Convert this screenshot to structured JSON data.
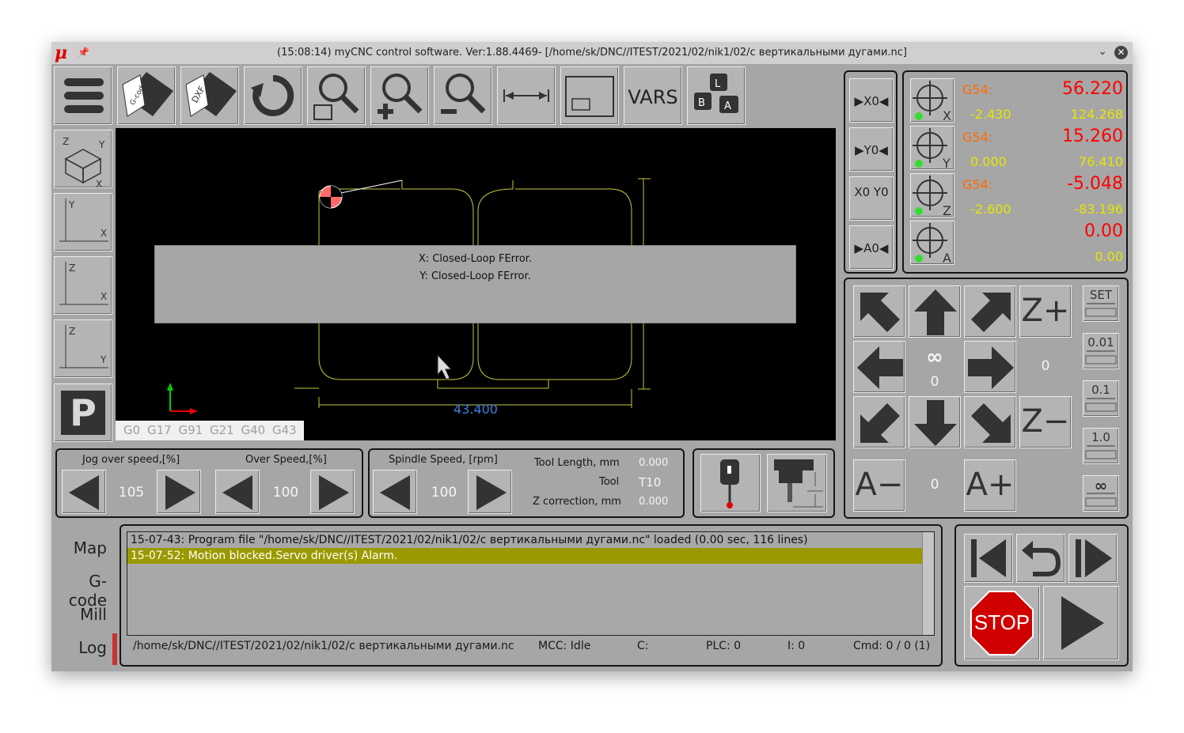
{
  "window": {
    "title": "(15:08:14) myCNC control software. Ver:1.88.4469- [/home/sk/DNC//ITEST/2021/02/nik1/02/с вертикальными дугами.nc]",
    "logo": "μ"
  },
  "toolbar": {
    "gcode_label": "G-code",
    "dxf_label": "DXF",
    "vars_label": "VARS"
  },
  "view_buttons": {
    "iso": {
      "a": "Z",
      "b": "Y",
      "c": "X"
    },
    "xy": {
      "a": "Y",
      "b": "X"
    },
    "zx": {
      "a": "Z",
      "b": "X"
    },
    "zy": {
      "a": "Z",
      "b": "Y"
    },
    "p_label": "P"
  },
  "viewport": {
    "error_line1": "X: Closed-Loop FError.",
    "error_line2": "Y: Closed-Loop FError.",
    "dimension": "43.400",
    "gcodes": [
      "G0",
      "G17",
      "G91",
      "G21",
      "G40",
      "G43"
    ]
  },
  "speed_panel": {
    "jog_label": "Jog over speed,[%]",
    "jog_value": "105",
    "over_label": "Over Speed,[%]",
    "over_value": "100"
  },
  "spindle_panel": {
    "spindle_label": "Spindle Speed, [rpm]",
    "spindle_value": "100",
    "tool_length_label": "Tool Length, mm",
    "tool_length_value": "0.000",
    "tool_label": "Tool",
    "tool_value": "T10",
    "zcorr_label": "Z correction, mm",
    "zcorr_value": "0.000"
  },
  "zero_buttons": [
    "▶X0◀",
    "▶Y0◀",
    "X0 Y0",
    "▶A0◀"
  ],
  "coordinates": [
    {
      "axis": "X",
      "wcs": "G54:",
      "main": "56.220",
      "sub1": "-2.430",
      "sub2": "124.268"
    },
    {
      "axis": "Y",
      "wcs": "G54:",
      "main": "15.260",
      "sub1": "0.000",
      "sub2": "76.410"
    },
    {
      "axis": "Z",
      "wcs": "G54:",
      "main": "-5.048",
      "sub1": "-2.600",
      "sub2": "-83.196"
    },
    {
      "axis": "A",
      "wcs": "",
      "main": "0.00",
      "sub1": "",
      "sub2": "0.00"
    }
  ],
  "jog": {
    "zplus": "Z+",
    "zminus": "Z−",
    "aminus": "A−",
    "aplus": "A+",
    "infinity": "∞",
    "xy_step": "0",
    "z_step": "0",
    "a_step": "0",
    "steps": [
      "SET",
      "0.01",
      "0.1",
      "1.0",
      "∞"
    ]
  },
  "side_tabs": [
    "Map",
    "G-code",
    "Mill",
    "Log"
  ],
  "log": {
    "lines": [
      "15-07-43: Program file \"/home/sk/DNC//ITEST/2021/02/nik1/02/с вертикальными дугами.nc\" loaded (0.00 sec, 116 lines)",
      "15-07-52: Motion blocked.Servo driver(s) Alarm."
    ]
  },
  "statusbar": {
    "file": "/home/sk/DNC//ITEST/2021/02/nik1/02/с вертикальными дугами.nc",
    "mcc": "MCC:  Idle",
    "c": "C:",
    "plc": "PLC:  0",
    "i": "I:  0",
    "cmd": "Cmd:  0  /  0 (1)"
  },
  "control": {
    "stop_label": "STOP"
  },
  "colors": {
    "panel": "#a6a6a6",
    "wcs": "#ff6a00",
    "main": "#ff0000",
    "sub": "#e6e600",
    "log_highlight": "#9a9a00",
    "stop": "#d00000"
  }
}
